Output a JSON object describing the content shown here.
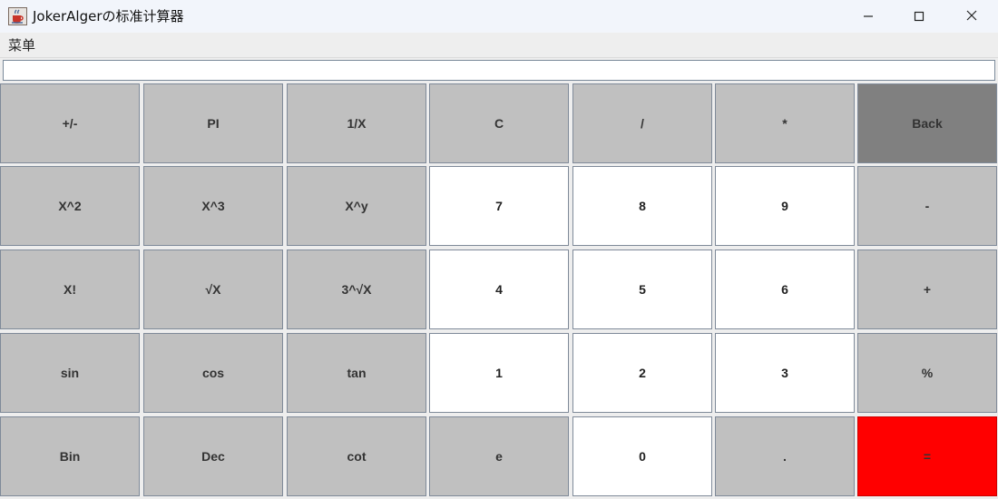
{
  "window": {
    "title": "JokerAlgerの标准计算器",
    "app_icon": "java-cup-icon",
    "controls": [
      "minimize-icon",
      "maximize-icon",
      "close-icon"
    ]
  },
  "menubar": {
    "menu_label": "菜单"
  },
  "display": {
    "value": ""
  },
  "colors": {
    "key_default": "#c0c0c0",
    "key_digit": "#ffffff",
    "key_back": "#808080",
    "key_equals": "#ff0000"
  },
  "keys": [
    [
      "+/-",
      "PI",
      "1/X",
      "C",
      "/",
      "*",
      "Back"
    ],
    [
      "X^2",
      "X^3",
      "X^y",
      "7",
      "8",
      "9",
      "-"
    ],
    [
      "X!",
      "√X",
      "3^√X",
      "4",
      "5",
      "6",
      "+"
    ],
    [
      "sin",
      "cos",
      "tan",
      "1",
      "2",
      "3",
      "%"
    ],
    [
      "Bin",
      "Dec",
      "cot",
      "e",
      "0",
      ".",
      "="
    ]
  ]
}
